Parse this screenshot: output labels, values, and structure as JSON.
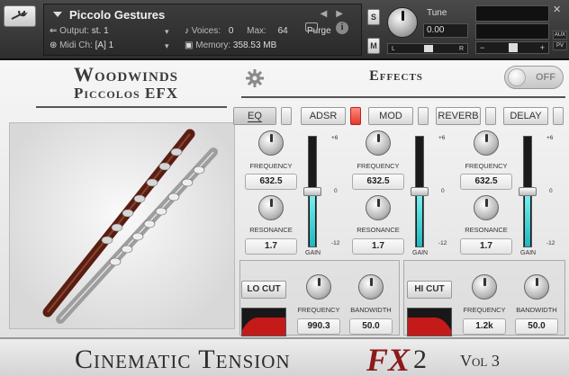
{
  "header": {
    "instrument_name": "Piccolo Gestures",
    "output_label": "Output:",
    "output_value": "st. 1",
    "midi_label": "Midi Ch:",
    "midi_value": "[A]  1",
    "voices_label": "Voices:",
    "voices_value": "0",
    "max_label": "Max:",
    "max_value": "64",
    "purge_label": "Purge",
    "memory_label": "Memory:",
    "memory_value": "358.53 MB",
    "solo_label": "S",
    "mute_label": "M",
    "tune_label": "Tune",
    "tune_value": "0.00",
    "pan_left": "L",
    "pan_right": "R",
    "vol_minus": "−",
    "vol_plus": "+",
    "aux_label": "AUX",
    "pv_label": "PV",
    "close_label": "✕"
  },
  "title": {
    "line1": "Woodwinds",
    "line2": "Piccolos EFX"
  },
  "effects": {
    "title": "Effects",
    "power_label": "OFF",
    "power_on": false,
    "tabs": [
      {
        "label": "EQ",
        "active": true,
        "led_on": false
      },
      {
        "label": "ADSR",
        "active": false,
        "led_on": true
      },
      {
        "label": "MOD",
        "active": false,
        "led_on": false
      },
      {
        "label": "REVERB",
        "active": false,
        "led_on": false
      },
      {
        "label": "DELAY",
        "active": false,
        "led_on": false
      }
    ]
  },
  "eq_bands": [
    {
      "frequency_label": "FREQUENCY",
      "frequency_value": "632.5",
      "resonance_label": "RESONANCE",
      "resonance_value": "1.7",
      "gain_label": "GAIN",
      "gain_fraction": 0.5
    },
    {
      "frequency_label": "FREQUENCY",
      "frequency_value": "632.5",
      "resonance_label": "RESONANCE",
      "resonance_value": "1.7",
      "gain_label": "GAIN",
      "gain_fraction": 0.5
    },
    {
      "frequency_label": "FREQUENCY",
      "frequency_value": "632.5",
      "resonance_label": "RESONANCE",
      "resonance_value": "1.7",
      "gain_label": "GAIN",
      "gain_fraction": 0.5
    }
  ],
  "gain_scale": {
    "top": "+6",
    "mid": "0",
    "bottom": "-12"
  },
  "lo_cut": {
    "label": "LO CUT",
    "frequency_label": "FREQUENCY",
    "frequency_value": "990.3",
    "bandwidth_label": "BANDWIDTH",
    "bandwidth_value": "50.0"
  },
  "hi_cut": {
    "label": "HI CUT",
    "frequency_label": "FREQUENCY",
    "frequency_value": "1.2k",
    "bandwidth_label": "BANDWIDTH",
    "bandwidth_value": "50.0"
  },
  "footer": {
    "main": "Cinematic Tension",
    "fx": "FX",
    "number": "2",
    "volume": "Vol 3"
  },
  "colors": {
    "fader_fill": "#2fc6cc",
    "led_on": "#e23b2a",
    "filter_curve": "#c41a1a",
    "fx_accent": "#8b1a1a"
  }
}
